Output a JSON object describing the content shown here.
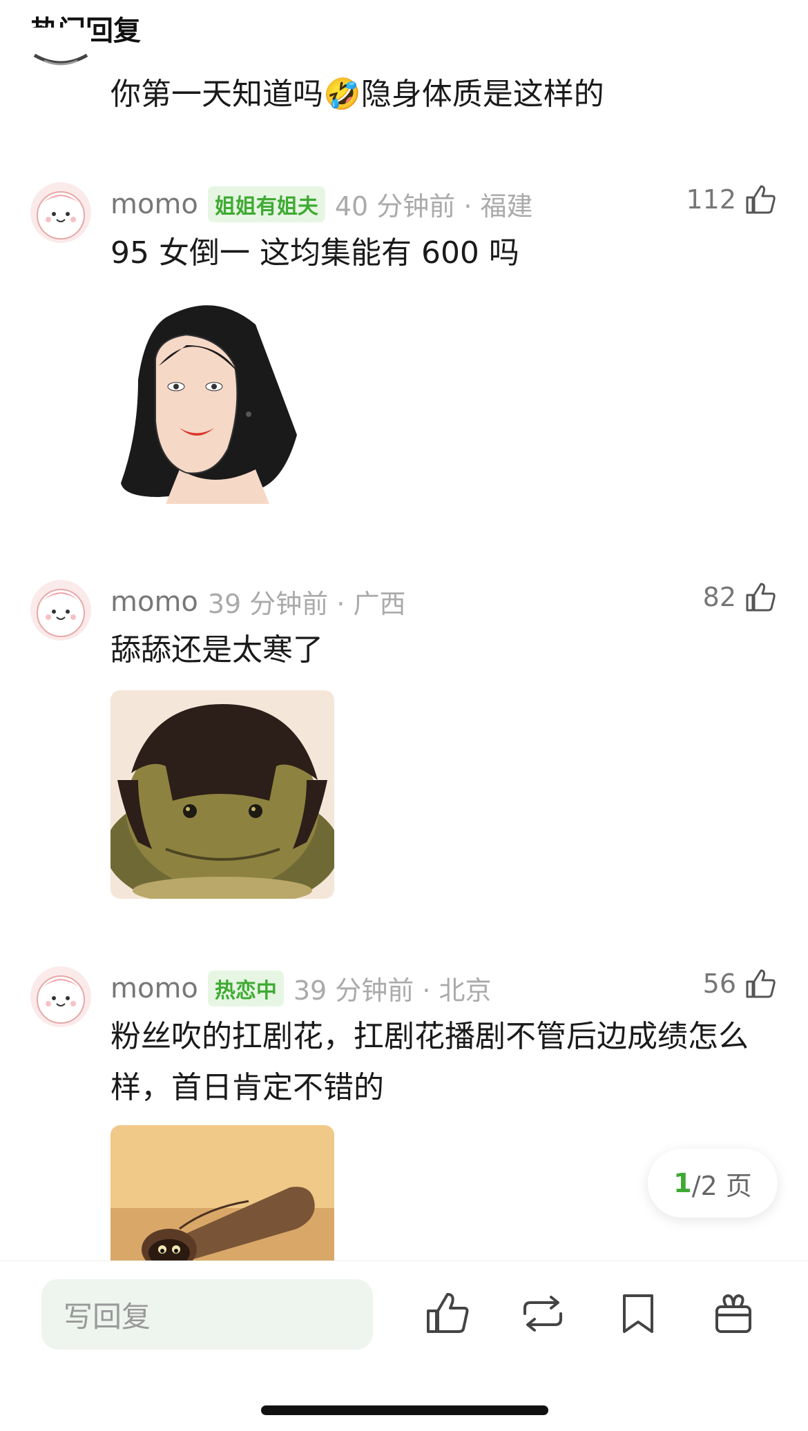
{
  "header": {
    "title": "热门回复"
  },
  "comments": [
    {
      "text": "你第一天知道吗🤣隐身体质是这样的"
    },
    {
      "username": "momo",
      "badge": "姐姐有姐夫",
      "time": "40 分钟前 · 福建",
      "likes": "112",
      "text": "95 女倒一 这均集能有 600 吗"
    },
    {
      "username": "momo",
      "badge": "",
      "time": "39 分钟前 · 广西",
      "likes": "82",
      "text": "舔舔还是太寒了"
    },
    {
      "username": "momo",
      "badge": "热恋中",
      "time": "39 分钟前 · 北京",
      "likes": "56",
      "text": "粉丝吹的扛剧花，扛剧花播剧不管后边成绩怎么样，首日肯定不错的"
    }
  ],
  "pager": {
    "current": "1",
    "total": "/2 页"
  },
  "bottom_bar": {
    "reply_placeholder": "写回复"
  },
  "colors": {
    "accent": "#3faa33",
    "badge_bg": "#e6f6e3"
  },
  "icons": [
    "thumbs-up-icon",
    "repost-icon",
    "bookmark-icon",
    "gift-icon"
  ]
}
